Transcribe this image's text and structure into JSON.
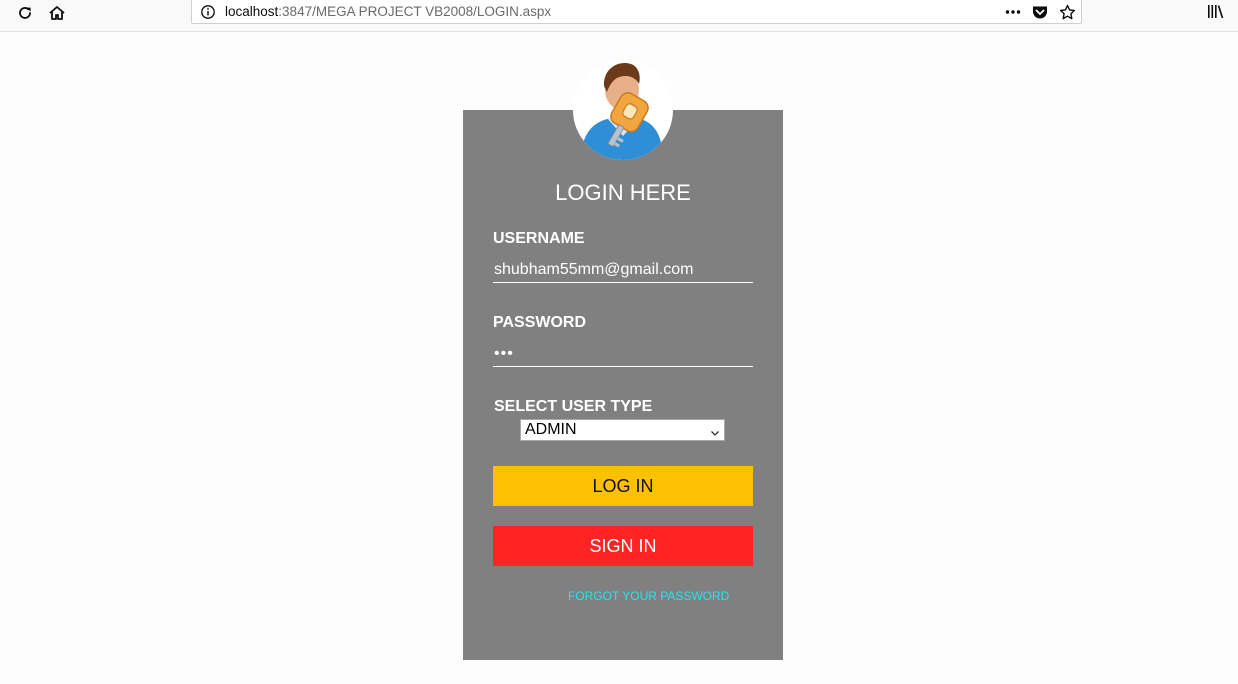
{
  "browser": {
    "url_host": "localhost",
    "url_rest": ":3847/MEGA PROJECT VB2008/LOGIN.aspx",
    "icons": [
      "reload-icon",
      "home-icon",
      "info-icon",
      "page-actions-icon",
      "pocket-icon",
      "bookmark-star-icon",
      "library-icon"
    ]
  },
  "login": {
    "title": "LOGIN HERE",
    "username_label": "USERNAME",
    "username_value": "shubham55mm@gmail.com",
    "password_label": "PASSWORD",
    "password_value": "abc",
    "user_type_label": "SELECT USER TYPE",
    "user_type_value": "ADMIN",
    "login_button": "LOG IN",
    "signin_button": "SIGN IN",
    "forgot_link": "FORGOT YOUR PASSWORD"
  },
  "colors": {
    "card_bg": "#808080",
    "login_button": "#fdc003",
    "signin_button": "#fe2424",
    "forgot_link": "#22e6f0"
  }
}
